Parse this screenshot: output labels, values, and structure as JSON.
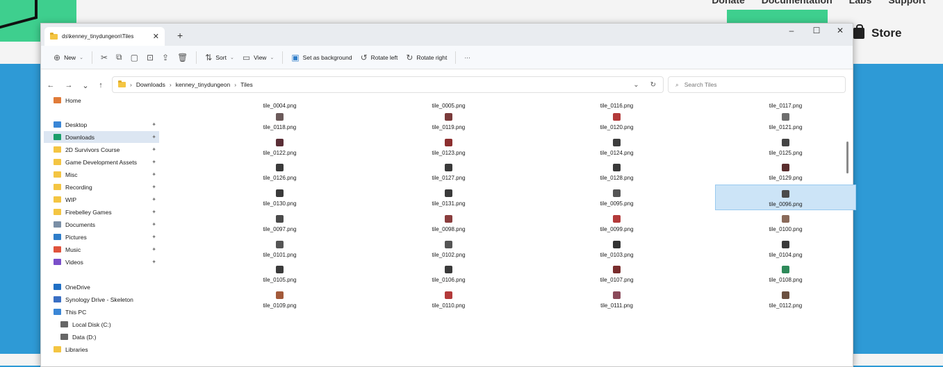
{
  "website": {
    "nav": [
      "Donate",
      "Documentation",
      "Labs",
      "Support"
    ],
    "store_label": "Store"
  },
  "window": {
    "tab_title": "ds\\kenney_tinydungeon\\Tiles",
    "controls": {
      "minimize": "–",
      "maximize": "☐",
      "close": "✕"
    }
  },
  "toolbar": {
    "new_label": "New",
    "sort_label": "Sort",
    "view_label": "View",
    "set_background_label": "Set as background",
    "rotate_left_label": "Rotate left",
    "rotate_right_label": "Rotate right",
    "more_label": "···"
  },
  "address": {
    "crumbs": [
      "Downloads",
      "kenney_tinydungeon",
      "Tiles"
    ]
  },
  "search": {
    "placeholder": "Search Tiles"
  },
  "sidebar": {
    "items": [
      {
        "label": "Home",
        "icon": "home-icon",
        "color": "#e07b39",
        "pinned": false
      },
      {
        "label": "Desktop",
        "icon": "desktop-icon",
        "color": "#3a86d6",
        "pinned": true
      },
      {
        "label": "Downloads",
        "icon": "download-icon",
        "color": "#1b9e6b",
        "pinned": true,
        "selected": true
      },
      {
        "label": "2D Survivors Course",
        "icon": "folder-icon",
        "color": "#f4c542",
        "pinned": true
      },
      {
        "label": "Game Development Assets",
        "icon": "folder-icon",
        "color": "#f4c542",
        "pinned": true
      },
      {
        "label": "Misc",
        "icon": "folder-icon",
        "color": "#f4c542",
        "pinned": true
      },
      {
        "label": "Recording",
        "icon": "folder-icon",
        "color": "#f4c542",
        "pinned": true
      },
      {
        "label": "WIP",
        "icon": "folder-icon",
        "color": "#f4c542",
        "pinned": true
      },
      {
        "label": "Firebelley Games",
        "icon": "folder-icon",
        "color": "#f4c542",
        "pinned": true
      },
      {
        "label": "Documents",
        "icon": "documents-icon",
        "color": "#7a8fa6",
        "pinned": true
      },
      {
        "label": "Pictures",
        "icon": "pictures-icon",
        "color": "#2f7dc9",
        "pinned": true
      },
      {
        "label": "Music",
        "icon": "music-icon",
        "color": "#e0533c",
        "pinned": true
      },
      {
        "label": "Videos",
        "icon": "videos-icon",
        "color": "#7a4fc9",
        "pinned": true
      },
      {
        "label": "OneDrive",
        "icon": "onedrive-icon",
        "color": "#1f6fc4",
        "pinned": false
      },
      {
        "label": "Synology Drive - Skeleton",
        "icon": "synology-icon",
        "color": "#3a6fc4",
        "pinned": false
      },
      {
        "label": "This PC",
        "icon": "pc-icon",
        "color": "#3a86d6",
        "pinned": false
      },
      {
        "label": "Local Disk (C:)",
        "icon": "disk-icon",
        "color": "#666666",
        "pinned": false
      },
      {
        "label": "Data (D:)",
        "icon": "disk-icon",
        "color": "#666666",
        "pinned": false
      },
      {
        "label": "Libraries",
        "icon": "libraries-icon",
        "color": "#f4c542",
        "pinned": false
      }
    ]
  },
  "files": {
    "top_row_names": [
      "tile_0004.png",
      "tile_0005.png",
      "tile_0116.png",
      "tile_0117.png"
    ],
    "tiles": [
      {
        "name": "tile_0118.png",
        "color": "#6b5a5a"
      },
      {
        "name": "tile_0119.png",
        "color": "#7a3b3b"
      },
      {
        "name": "tile_0120.png",
        "color": "#b33a3a"
      },
      {
        "name": "tile_0121.png",
        "color": "#6e6e6e"
      },
      {
        "name": "tile_0122.png",
        "color": "#5a2e36"
      },
      {
        "name": "tile_0123.png",
        "color": "#8c2f2f"
      },
      {
        "name": "tile_0124.png",
        "color": "#3d3d3d"
      },
      {
        "name": "tile_0125.png",
        "color": "#444444"
      },
      {
        "name": "tile_0126.png",
        "color": "#3a3a3a"
      },
      {
        "name": "tile_0127.png",
        "color": "#3a3a3a"
      },
      {
        "name": "tile_0128.png",
        "color": "#3a3a3a"
      },
      {
        "name": "tile_0129.png",
        "color": "#5a2e2e"
      },
      {
        "name": "tile_0130.png",
        "color": "#3a3a3a"
      },
      {
        "name": "tile_0131.png",
        "color": "#3a3a3a"
      },
      {
        "name": "tile_0095.png",
        "color": "#555555"
      },
      {
        "name": "tile_0096.png",
        "color": "#4a4a4a",
        "selected": true
      },
      {
        "name": "tile_0097.png",
        "color": "#4a4a4a"
      },
      {
        "name": "tile_0098.png",
        "color": "#8a3d3d"
      },
      {
        "name": "tile_0099.png",
        "color": "#b33a3a"
      },
      {
        "name": "tile_0100.png",
        "color": "#8a6a5a"
      },
      {
        "name": "tile_0101.png",
        "color": "#555555"
      },
      {
        "name": "tile_0102.png",
        "color": "#555555"
      },
      {
        "name": "tile_0103.png",
        "color": "#333333"
      },
      {
        "name": "tile_0104.png",
        "color": "#3a3a3a"
      },
      {
        "name": "tile_0105.png",
        "color": "#3a3a3a"
      },
      {
        "name": "tile_0106.png",
        "color": "#3a3a3a"
      },
      {
        "name": "tile_0107.png",
        "color": "#7a2e2e"
      },
      {
        "name": "tile_0108.png",
        "color": "#2e8a5a"
      },
      {
        "name": "tile_0109.png",
        "color": "#a35a3a"
      },
      {
        "name": "tile_0110.png",
        "color": "#b33a3a"
      },
      {
        "name": "tile_0111.png",
        "color": "#8a4a5a"
      },
      {
        "name": "tile_0112.png",
        "color": "#6b5040"
      }
    ]
  }
}
